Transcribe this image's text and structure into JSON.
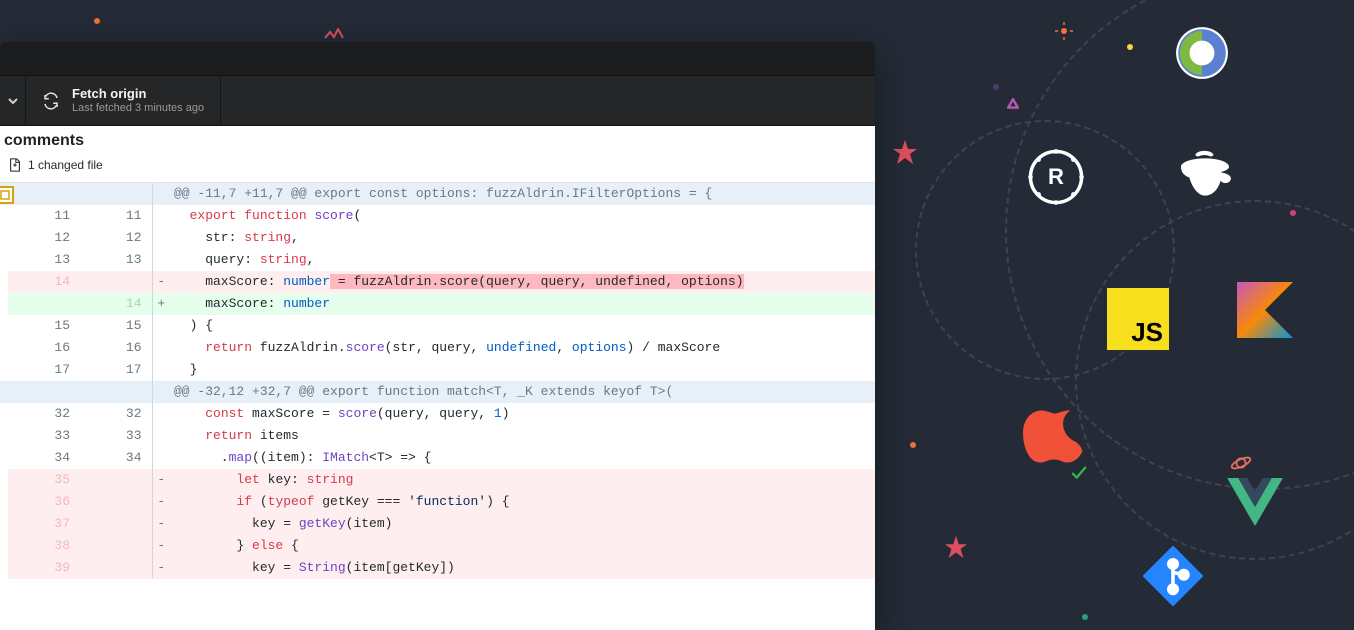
{
  "toolbar": {
    "fetch_title": "Fetch origin",
    "fetch_subtitle": "Last fetched 3 minutes ago"
  },
  "header": {
    "title": "comments",
    "changed_files": "1 changed file"
  },
  "diff": {
    "rows": [
      {
        "type": "hunk",
        "a": "",
        "b": "",
        "text": "@@ -11,7 +11,7 @@ export const options: fuzzAldrin.IFilterOptions = {"
      },
      {
        "type": "ctx",
        "a": "11",
        "b": "11",
        "tokens": [
          [
            "  ",
            ""
          ],
          [
            "export ",
            "kw-red"
          ],
          [
            "function ",
            "kw-red"
          ],
          [
            "score",
            "fn-purple"
          ],
          [
            "(",
            ""
          ]
        ]
      },
      {
        "type": "ctx",
        "a": "12",
        "b": "12",
        "tokens": [
          [
            "    str: ",
            ""
          ],
          [
            "string",
            "kw-red"
          ],
          [
            ",",
            ""
          ]
        ]
      },
      {
        "type": "ctx",
        "a": "13",
        "b": "13",
        "tokens": [
          [
            "    query: ",
            ""
          ],
          [
            "string",
            "kw-red"
          ],
          [
            ",",
            ""
          ]
        ]
      },
      {
        "type": "del",
        "a": "14",
        "b": "",
        "tokens": [
          [
            "    maxScore: ",
            ""
          ],
          [
            "number",
            "kw-blue"
          ],
          [
            " = fuzzAldrin.score(query, query, undefined, options)",
            "del-frag"
          ]
        ]
      },
      {
        "type": "add",
        "a": "",
        "b": "14",
        "tokens": [
          [
            "    maxScore: ",
            ""
          ],
          [
            "number",
            "kw-blue"
          ]
        ]
      },
      {
        "type": "ctx",
        "a": "15",
        "b": "15",
        "tokens": [
          [
            "  ) {",
            ""
          ]
        ]
      },
      {
        "type": "ctx",
        "a": "16",
        "b": "16",
        "tokens": [
          [
            "    ",
            ""
          ],
          [
            "return ",
            "kw-red"
          ],
          [
            "fuzzAldrin.",
            ""
          ],
          [
            "score",
            "fn-purple"
          ],
          [
            "(str, query, ",
            ""
          ],
          [
            "undefined",
            "kw-blue"
          ],
          [
            ", ",
            ""
          ],
          [
            "options",
            "kw-blue"
          ],
          [
            ") / maxScore",
            ""
          ]
        ]
      },
      {
        "type": "ctx",
        "a": "17",
        "b": "17",
        "tokens": [
          [
            "  }",
            ""
          ]
        ]
      },
      {
        "type": "hunk",
        "a": "",
        "b": "",
        "text": "@@ -32,12 +32,7 @@ export function match<T, _K extends keyof T>("
      },
      {
        "type": "ctx",
        "a": "32",
        "b": "32",
        "tokens": [
          [
            "    ",
            ""
          ],
          [
            "const ",
            "kw-red"
          ],
          [
            "maxScore = ",
            ""
          ],
          [
            "score",
            "fn-purple"
          ],
          [
            "(query, query, ",
            ""
          ],
          [
            "1",
            "kw-blue"
          ],
          [
            ")",
            ""
          ]
        ]
      },
      {
        "type": "ctx",
        "a": "33",
        "b": "33",
        "tokens": [
          [
            "    ",
            ""
          ],
          [
            "return ",
            "kw-red"
          ],
          [
            "items",
            ""
          ]
        ]
      },
      {
        "type": "ctx",
        "a": "34",
        "b": "34",
        "tokens": [
          [
            "      .",
            ""
          ],
          [
            "map",
            "fn-purple"
          ],
          [
            "((item): ",
            ""
          ],
          [
            "IMatch",
            "fn-purple"
          ],
          [
            "<T> => {",
            ""
          ]
        ]
      },
      {
        "type": "del",
        "a": "35",
        "b": "",
        "tokens": [
          [
            "        ",
            ""
          ],
          [
            "let ",
            "kw-red"
          ],
          [
            "key: ",
            ""
          ],
          [
            "string",
            "kw-red"
          ]
        ]
      },
      {
        "type": "del",
        "a": "36",
        "b": "",
        "tokens": [
          [
            "        ",
            ""
          ],
          [
            "if ",
            "kw-red"
          ],
          [
            "(",
            ""
          ],
          [
            "typeof ",
            "kw-red"
          ],
          [
            "getKey === ",
            ""
          ],
          [
            "'function'",
            "str-blue"
          ],
          [
            ") {",
            ""
          ]
        ]
      },
      {
        "type": "del",
        "a": "37",
        "b": "",
        "tokens": [
          [
            "          key = ",
            ""
          ],
          [
            "getKey",
            "fn-purple"
          ],
          [
            "(item)",
            ""
          ]
        ]
      },
      {
        "type": "del",
        "a": "38",
        "b": "",
        "tokens": [
          [
            "        } ",
            ""
          ],
          [
            "else ",
            "kw-red"
          ],
          [
            "{",
            ""
          ]
        ]
      },
      {
        "type": "del",
        "a": "39",
        "b": "",
        "tokens": [
          [
            "          key = ",
            ""
          ],
          [
            "String",
            "fn-purple"
          ],
          [
            "(item[getKey])",
            ""
          ]
        ]
      }
    ]
  },
  "icons": {
    "clojure": "clojure-icon",
    "coffee": "coffeescript-icon",
    "rust": "rust-icon",
    "js": "JS",
    "kotlin": "kotlin-icon",
    "swift": "swift-icon",
    "vue": "vue-icon",
    "git": "git-icon"
  }
}
